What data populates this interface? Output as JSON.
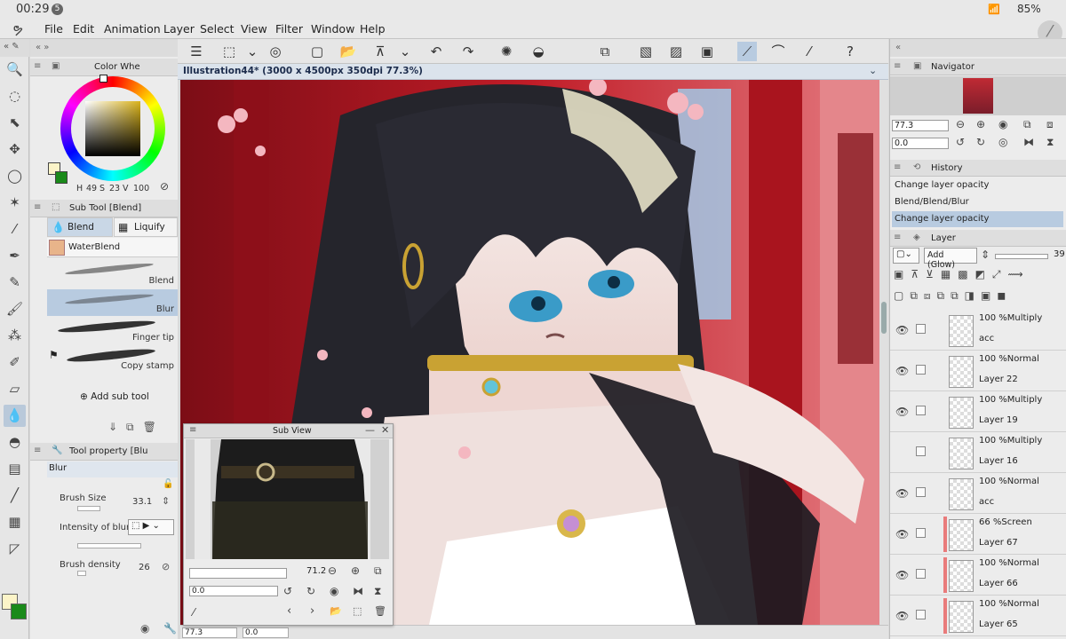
{
  "status_bar": {
    "time": "00:29",
    "notification_count": "5",
    "battery": "85%"
  },
  "menu": [
    "File",
    "Edit",
    "Animation",
    "Layer",
    "Select",
    "View",
    "Filter",
    "Window",
    "Help"
  ],
  "document": {
    "title": "Illustration44* (3000 x 4500px 350dpi 77.3%)"
  },
  "color_panel": {
    "title": "Color Whe",
    "h_label": "H",
    "h": "49",
    "s_label": "S",
    "s": "23",
    "v_label": "V",
    "v": "100",
    "main_color": "#fcf4c8",
    "sub_color": "#1a8a1a"
  },
  "subtool_panel": {
    "title": "Sub Tool [Blend]",
    "tabs": [
      "Blend",
      "Liquify"
    ],
    "group": "WaterBlend",
    "brushes": [
      "Blend",
      "Blur",
      "Finger tip",
      "Copy stamp"
    ],
    "selected_brush": "Blur",
    "add_label": "Add sub tool"
  },
  "tool_property": {
    "title": "Tool property [Blu",
    "name": "Blur",
    "brush_size_label": "Brush Size",
    "brush_size": "33.1",
    "intensity_label": "Intensity of blur",
    "density_label": "Brush density",
    "density": "26"
  },
  "sub_view": {
    "title": "Sub View",
    "zoom": "71.2",
    "rotation": "0.0"
  },
  "navigator": {
    "title": "Navigator",
    "zoom": "77.3",
    "rotation": "0.0"
  },
  "history": {
    "title": "History",
    "items": [
      "Change layer opacity",
      "Blend/Blend/Blur",
      "Change layer opacity"
    ],
    "selected_index": 2
  },
  "layer_panel": {
    "title": "Layer",
    "blend_mode": "Add (Glow)",
    "opacity": "39",
    "layers": [
      {
        "mode": "100 %Multiply",
        "name": "acc",
        "visible": true,
        "marker": ""
      },
      {
        "mode": "100 %Normal",
        "name": "Layer 22",
        "visible": true,
        "marker": ""
      },
      {
        "mode": "100 %Multiply",
        "name": "Layer 19",
        "visible": true,
        "marker": ""
      },
      {
        "mode": "100 %Multiply",
        "name": "Layer 16",
        "visible": false,
        "marker": ""
      },
      {
        "mode": "100 %Normal",
        "name": "acc",
        "visible": true,
        "marker": ""
      },
      {
        "mode": "66 %Screen",
        "name": "Layer 67",
        "visible": true,
        "marker": "#e97b7b"
      },
      {
        "mode": "100 %Normal",
        "name": "Layer 66",
        "visible": true,
        "marker": "#e97b7b"
      },
      {
        "mode": "100 %Normal",
        "name": "Layer 65",
        "visible": true,
        "marker": "#e97b7b"
      }
    ]
  },
  "bottom_bar": {
    "zoom": "77.3",
    "rotation": "0.0"
  }
}
